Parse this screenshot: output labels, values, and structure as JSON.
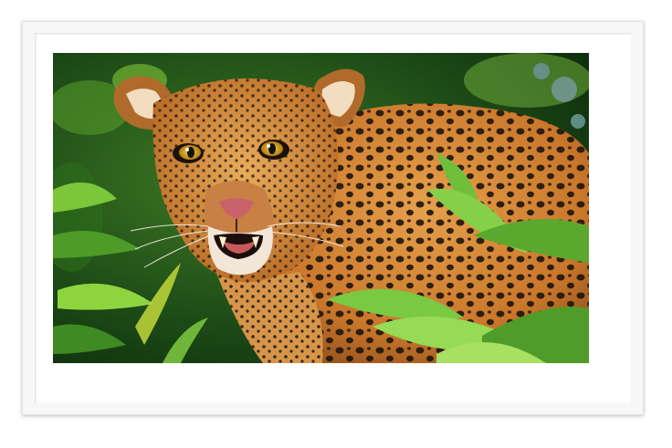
{
  "artwork": {
    "subject": "leopard-in-jungle-foliage",
    "colors": {
      "frame": "#f7f7f7",
      "mat": "#ffffff",
      "fur": "#d8862e",
      "spots": "#1c140d",
      "foliage_dark": "#143a12",
      "foliage_light": "#7fcf3a",
      "eyes": "#e0b431",
      "nose": "#c9626a"
    }
  }
}
